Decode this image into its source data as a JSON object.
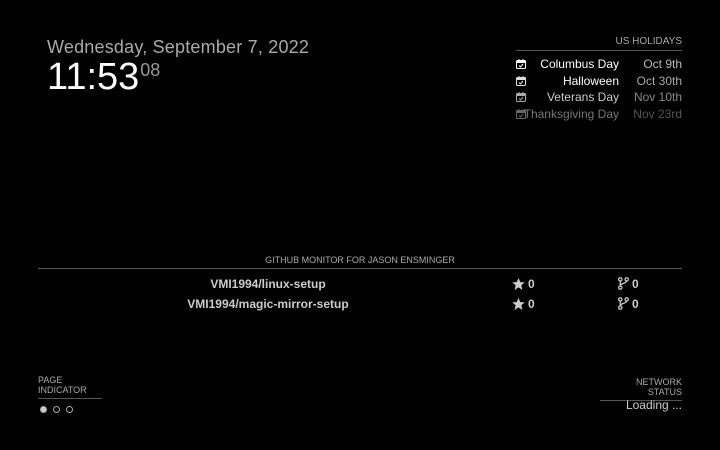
{
  "clock": {
    "date": "Wednesday, September 7, 2022",
    "hours_minutes": "11:53",
    "seconds": "08"
  },
  "holidays": {
    "title": "US HOLIDAYS",
    "items": [
      {
        "name": "Columbus Day",
        "date": "Oct 9th",
        "name_color": "#ffffff",
        "date_color": "#bbbbbb"
      },
      {
        "name": "Halloween",
        "date": "Oct 30th",
        "name_color": "#ffffff",
        "date_color": "#aaaaaa"
      },
      {
        "name": "Veterans Day",
        "date": "Nov 10th",
        "name_color": "#cccccc",
        "date_color": "#888888"
      },
      {
        "name": "Thanksgiving Day",
        "date": "Nov 23rd",
        "name_color": "#777777",
        "date_color": "#555555"
      }
    ],
    "icon": "calendar-check-icon"
  },
  "github": {
    "title": "GITHUB MONITOR FOR JASON ENSMINGER",
    "repos": [
      {
        "name": "VMI1994/linux-setup",
        "stars": "0",
        "forks": "0"
      },
      {
        "name": "VMI1994/magic-mirror-setup",
        "stars": "0",
        "forks": "0"
      }
    ]
  },
  "page_indicator": {
    "title": "PAGE INDICATOR",
    "pages": 3,
    "active_page": 1
  },
  "network": {
    "title": "NETWORK STATUS",
    "status": "Loading ..."
  }
}
